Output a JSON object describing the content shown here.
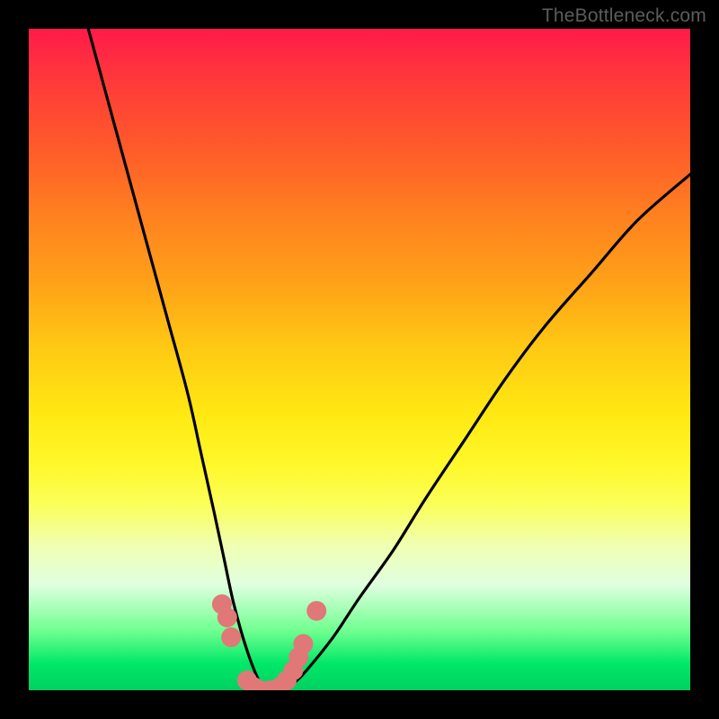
{
  "watermark": "TheBottleneck.com",
  "chart_data": {
    "type": "line",
    "title": "",
    "xlabel": "",
    "ylabel": "",
    "xlim": [
      0,
      100
    ],
    "ylim": [
      0,
      100
    ],
    "series": [
      {
        "name": "bottleneck-curve",
        "x": [
          9,
          12,
          15,
          18,
          21,
          24,
          26,
          28,
          29.5,
          31,
          33,
          35,
          36,
          37,
          38.5,
          40,
          42,
          46,
          50,
          55,
          60,
          66,
          72,
          78,
          85,
          92,
          100
        ],
        "values": [
          100,
          89,
          78,
          67,
          56,
          45,
          36,
          27,
          20,
          13,
          6,
          1,
          0,
          0,
          0,
          1,
          3,
          8,
          14,
          21,
          29,
          38,
          47,
          55,
          63,
          71,
          78
        ]
      }
    ],
    "markers": {
      "name": "highlighted-points",
      "color": "#e07878",
      "points": [
        {
          "x": 29.2,
          "y": 13
        },
        {
          "x": 30.0,
          "y": 11
        },
        {
          "x": 30.6,
          "y": 8
        },
        {
          "x": 33.0,
          "y": 1.5
        },
        {
          "x": 34.0,
          "y": 0.5
        },
        {
          "x": 35.0,
          "y": 0
        },
        {
          "x": 36.5,
          "y": 0
        },
        {
          "x": 38.0,
          "y": 0.5
        },
        {
          "x": 39.0,
          "y": 1.5
        },
        {
          "x": 40.0,
          "y": 3
        },
        {
          "x": 40.8,
          "y": 5
        },
        {
          "x": 41.5,
          "y": 7
        },
        {
          "x": 43.5,
          "y": 12
        }
      ]
    },
    "colors": {
      "high": "#ff1a4a",
      "mid": "#ffe812",
      "low": "#00d060",
      "curve": "#000000",
      "marker": "#e07878"
    }
  }
}
